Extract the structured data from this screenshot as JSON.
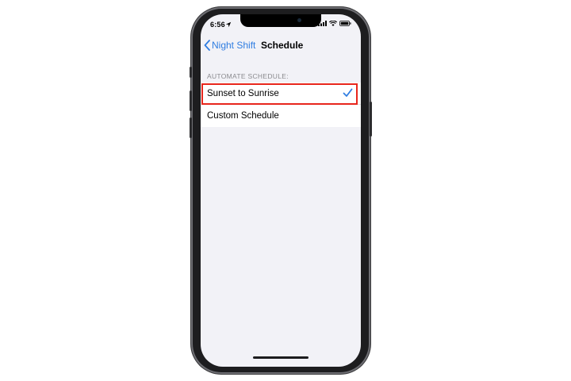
{
  "status_bar": {
    "time": "6:56"
  },
  "nav": {
    "back_label": "Night Shift",
    "title": "Schedule"
  },
  "section": {
    "header": "AUTOMATE SCHEDULE:"
  },
  "options": [
    {
      "label": "Sunset to Sunrise",
      "selected": true
    },
    {
      "label": "Custom Schedule",
      "selected": false
    }
  ],
  "colors": {
    "accent": "#2f7de1",
    "highlight": "#e8261c",
    "background": "#f2f2f7"
  },
  "icons": {
    "back": "chevron-left-icon",
    "check": "checkmark-icon",
    "location": "location-arrow-icon",
    "signal": "cellular-signal-icon",
    "wifi": "wifi-icon",
    "battery": "battery-icon"
  }
}
